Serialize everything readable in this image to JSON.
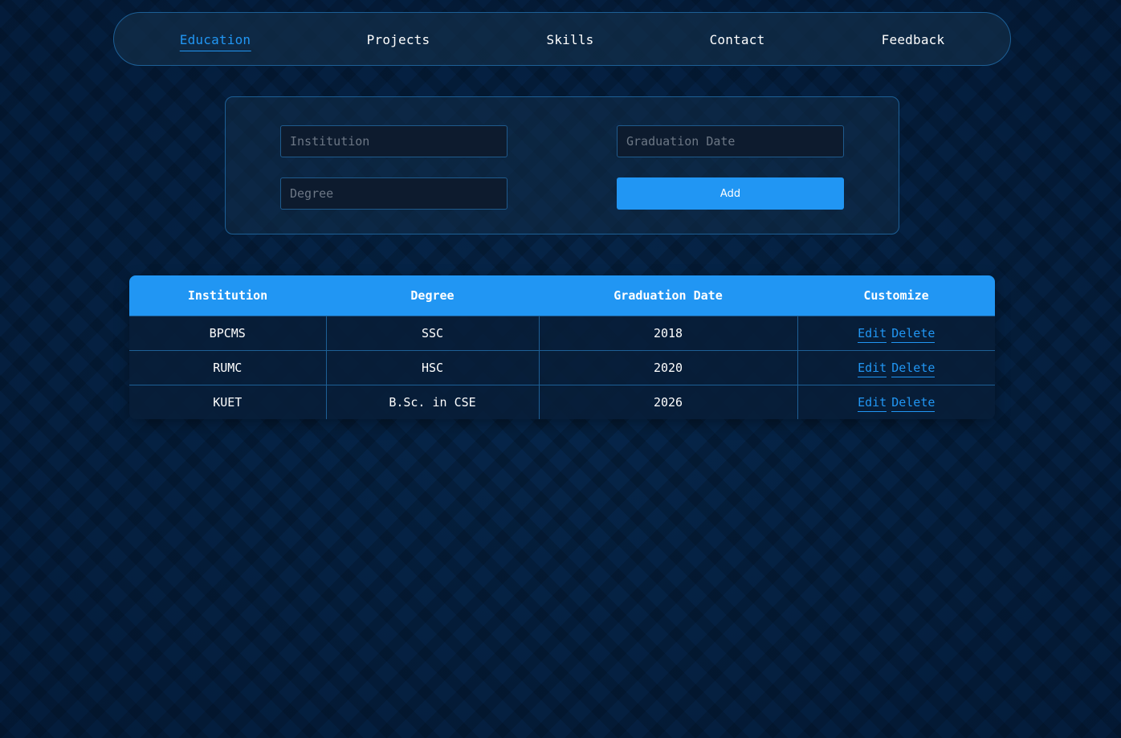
{
  "nav": {
    "items": [
      {
        "label": "Education",
        "active": true
      },
      {
        "label": "Projects",
        "active": false
      },
      {
        "label": "Skills",
        "active": false
      },
      {
        "label": "Contact",
        "active": false
      },
      {
        "label": "Feedback",
        "active": false
      }
    ]
  },
  "form": {
    "institution_placeholder": "Institution",
    "graduation_placeholder": "Graduation Date",
    "degree_placeholder": "Degree",
    "add_label": "Add"
  },
  "table": {
    "headers": [
      "Institution",
      "Degree",
      "Graduation Date",
      "Customize"
    ],
    "rows": [
      {
        "institution": "BPCMS",
        "degree": "SSC",
        "graduation": "2018"
      },
      {
        "institution": "RUMC",
        "degree": "HSC",
        "graduation": "2020"
      },
      {
        "institution": "KUET",
        "degree": "B.Sc. in CSE",
        "graduation": "2026"
      }
    ],
    "edit_label": "Edit",
    "delete_label": "Delete"
  },
  "colors": {
    "accent": "#2196f3",
    "background": "#06264a",
    "border": "#1d5f95"
  }
}
